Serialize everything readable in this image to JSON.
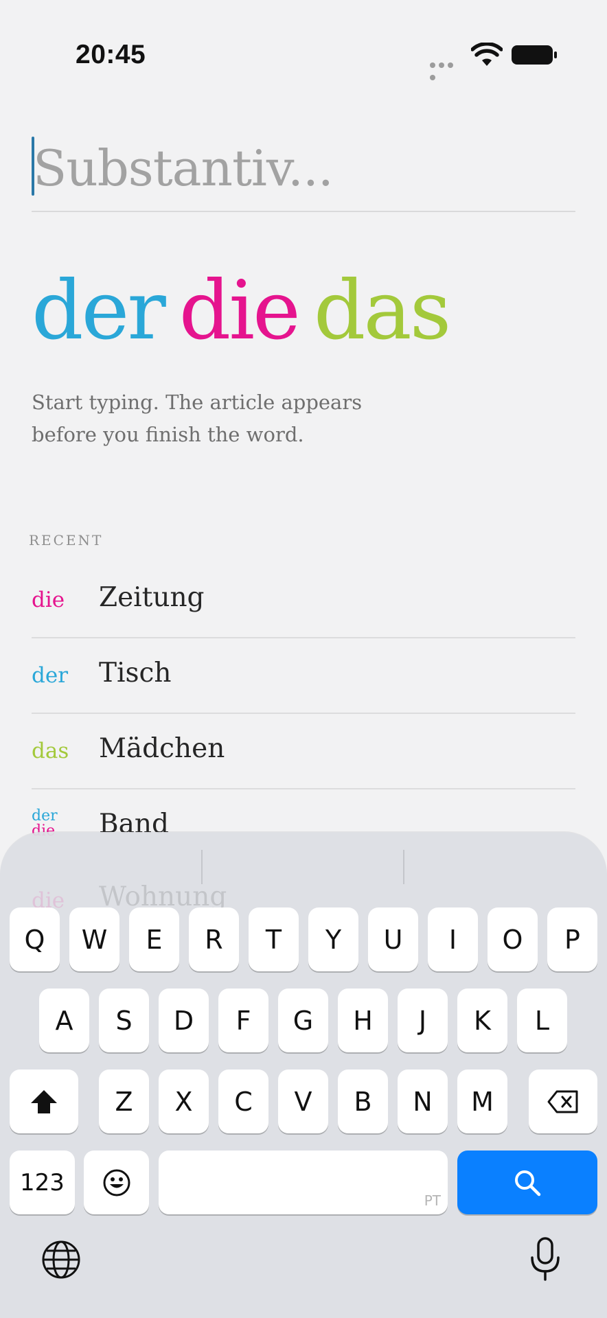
{
  "status_bar": {
    "time": "20:45",
    "icons": [
      "signal-dots-icon",
      "wifi-icon",
      "battery-icon"
    ]
  },
  "search": {
    "placeholder": "Substantiv...",
    "value": ""
  },
  "articles": {
    "der": "der",
    "die": "die",
    "das": "das"
  },
  "hint": "Start typing. The article appears before you finish the word.",
  "recent": {
    "label": "RECENT",
    "items": [
      {
        "article": "die",
        "word": "Zeitung"
      },
      {
        "article": "der",
        "word": "Tisch"
      },
      {
        "article": "das",
        "word": "Mädchen"
      },
      {
        "article_top": "der",
        "article_bottom": "die",
        "word": "Band"
      }
    ]
  },
  "colors": {
    "der": "#2aa7d8",
    "die": "#e5148e",
    "das": "#a3c93b",
    "search_key": "#0a80ff",
    "background": "#f2f2f3"
  },
  "keyboard": {
    "row1": [
      "Q",
      "W",
      "E",
      "R",
      "T",
      "Y",
      "U",
      "I",
      "O",
      "P"
    ],
    "row2": [
      "A",
      "S",
      "D",
      "F",
      "G",
      "H",
      "J",
      "K",
      "L"
    ],
    "row3": [
      "Z",
      "X",
      "C",
      "V",
      "B",
      "N",
      "M"
    ],
    "numbers_label": "123",
    "space_hint": "PT",
    "icons": [
      "shift-icon",
      "delete-icon",
      "emoji-icon",
      "search-icon",
      "globe-icon",
      "microphone-icon"
    ]
  }
}
